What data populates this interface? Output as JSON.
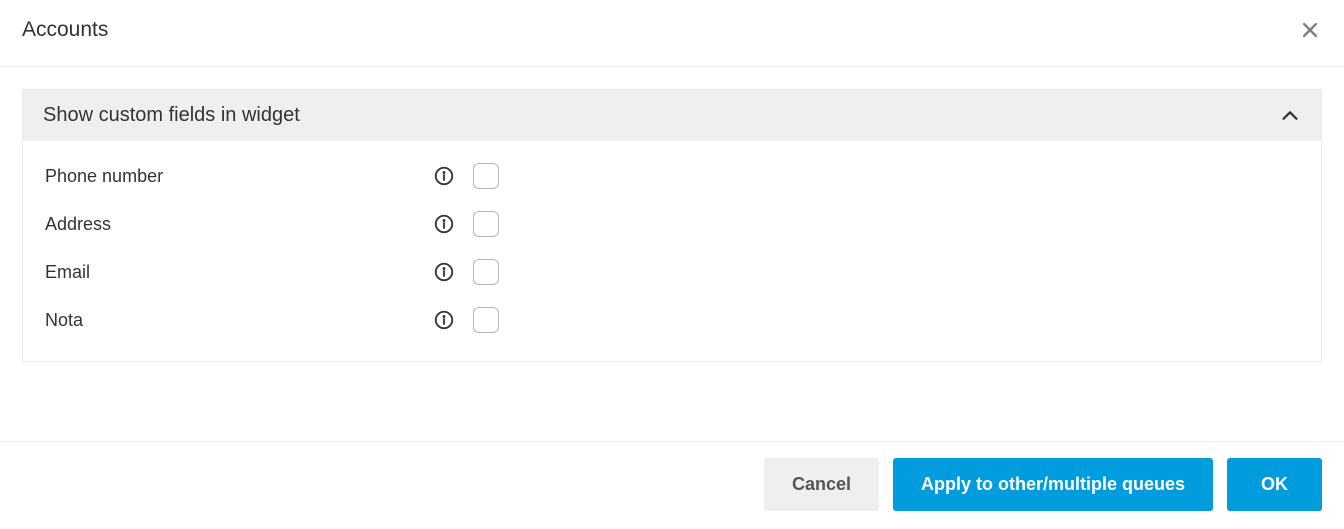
{
  "header": {
    "title": "Accounts"
  },
  "section": {
    "title": "Show custom fields in widget"
  },
  "fields": [
    {
      "label": "Phone number"
    },
    {
      "label": "Address"
    },
    {
      "label": "Email"
    },
    {
      "label": "Nota"
    }
  ],
  "footer": {
    "cancel": "Cancel",
    "apply": "Apply to other/multiple queues",
    "ok": "OK"
  }
}
